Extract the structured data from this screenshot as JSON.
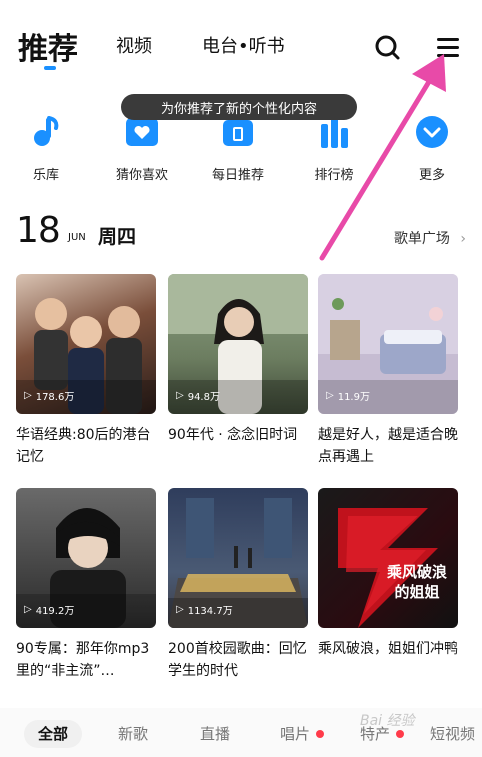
{
  "topnav": {
    "tabs": [
      {
        "label": "推荐"
      },
      {
        "label": "视频"
      },
      {
        "label": "电台•听书"
      }
    ],
    "search_icon": "search-icon",
    "menu_icon": "menu-icon"
  },
  "toast": "为你推荐了新的个性化内容",
  "shortcuts": [
    {
      "label": "乐库",
      "icon": "music-note-icon"
    },
    {
      "label": "猜你喜欢",
      "icon": "heart-card-icon"
    },
    {
      "label": "每日推荐",
      "icon": "calendar-icon"
    },
    {
      "label": "排行榜",
      "icon": "chart-bars-icon"
    },
    {
      "label": "更多",
      "icon": "chevron-down-circle-icon"
    }
  ],
  "date": {
    "day": "18",
    "month": "JUN",
    "weekday": "周四",
    "playlist_square": "歌单广场"
  },
  "cards": [
    {
      "plays": "178.6万",
      "title": "华语经典:80后的港台记忆"
    },
    {
      "plays": "94.8万",
      "title": "90年代 · 念念旧时词"
    },
    {
      "plays": "11.9万",
      "title": "越是好人，越是适合晚点再遇上"
    },
    {
      "plays": "419.2万",
      "title": "90专属：那年你mp3里的“非主流”…"
    },
    {
      "plays": "1134.7万",
      "title": "200首校园歌曲：回忆学生的时代"
    },
    {
      "plays": "",
      "title": "乘风破浪，姐姐们冲鸭",
      "poster_text": "乘风破浪 的姐姐"
    }
  ],
  "filters": [
    {
      "label": "全部",
      "dot": false
    },
    {
      "label": "新歌",
      "dot": false
    },
    {
      "label": "直播",
      "dot": false
    },
    {
      "label": "唱片",
      "dot": true
    },
    {
      "label": "特产",
      "dot": true
    },
    {
      "label": "短视频",
      "dot": false
    }
  ],
  "watermark": "Bai 经验",
  "colors": {
    "accent": "#1a90ff",
    "arrow": "#e84aa8",
    "badge": "#ff3b4a",
    "poster_red": "#c0121c"
  }
}
